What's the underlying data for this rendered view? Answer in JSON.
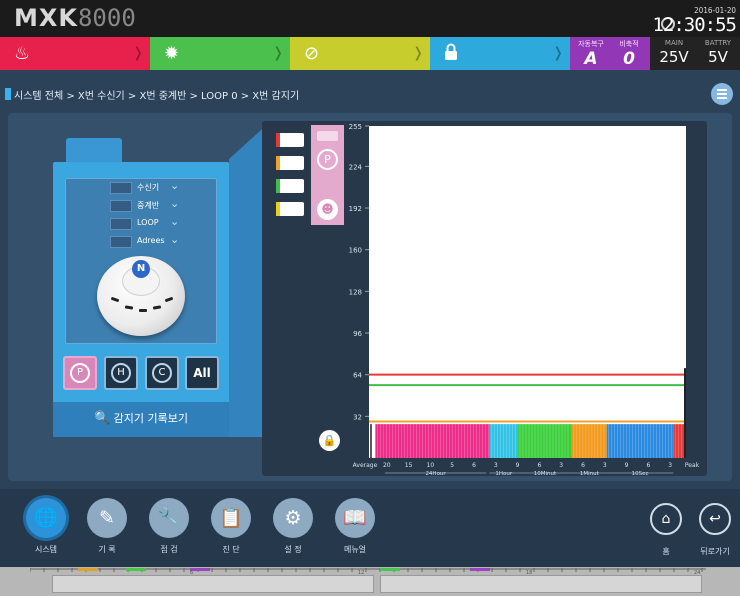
{
  "header": {
    "logo_text": "MXK",
    "logo_num": "8000",
    "date": "2016-01-20",
    "time": "12:30:55"
  },
  "status": {
    "fire_icon": "flame-icon",
    "trouble_icon": "gear-icon",
    "supervisory_icon": "no-entry-icon",
    "security_icon": "lock-icon",
    "auto_restore_label": "자동복구",
    "auto_restore_value": "A",
    "non_fire_label": "비축적",
    "non_fire_value": "0",
    "main_label": "MAIN",
    "main_value": "25V",
    "battery_label": "BATTRY",
    "battery_value": "5V",
    "colors": {
      "fire": "#e8214c",
      "trouble": "#4cc04d",
      "supervisory": "#c6cd2c",
      "security": "#2da9dc",
      "mode": "#9238b6"
    }
  },
  "breadcrumb": "시스템 전체 > X번 수신기 > X번 중계반 > LOOP 0 > X번 감지기",
  "selector": {
    "rows": [
      "수신기",
      "중계반",
      "LOOP",
      "Adrees"
    ],
    "detector_badge": "N",
    "mode_buttons": [
      "P",
      "H",
      "C",
      "All"
    ],
    "history_icon": "search-icon",
    "history_label": "감지기 기록보기"
  },
  "legend": {
    "colors": [
      "#e63a3a",
      "#f2a22c",
      "#3fbf4a",
      "#e6d21e"
    ],
    "p_label": "P"
  },
  "chart_data": {
    "type": "line",
    "ylim": [
      0,
      255
    ],
    "yticks": [
      32,
      64,
      96,
      128,
      160,
      192,
      224,
      255
    ],
    "thresholds": [
      {
        "value": 64,
        "color": "#e63a3a"
      },
      {
        "value": 56,
        "color": "#3fbf4a"
      },
      {
        "value": 28,
        "color": "#f2a22c"
      }
    ],
    "segments": [
      {
        "color": "#ee2d8a",
        "start": 0.02,
        "end": 0.38
      },
      {
        "color": "#31c2e6",
        "start": 0.38,
        "end": 0.47
      },
      {
        "color": "#3ccf3c",
        "start": 0.47,
        "end": 0.64
      },
      {
        "color": "#f29a1c",
        "start": 0.64,
        "end": 0.75
      },
      {
        "color": "#2b8ae0",
        "start": 0.75,
        "end": 0.96
      },
      {
        "color": "#e63a3a",
        "start": 0.96,
        "end": 1.0
      }
    ],
    "x_labels": [
      "Average",
      "20",
      "15",
      "10",
      "5",
      "6",
      "3",
      "9",
      "6",
      "3",
      "6",
      "3",
      "9",
      "6",
      "3",
      "Peak"
    ],
    "x_groups": [
      "24Hour",
      "1Hour",
      "10Minut",
      "1Minut",
      "10Sec"
    ]
  },
  "nav": {
    "items": [
      {
        "label": "시스템",
        "icon": "globe-icon"
      },
      {
        "label": "기  록",
        "icon": "pencil-icon"
      },
      {
        "label": "점  검",
        "icon": "wrench-icon"
      },
      {
        "label": "진  단",
        "icon": "clipboard-icon"
      },
      {
        "label": "설  정",
        "icon": "gear-icon"
      },
      {
        "label": "메뉴얼",
        "icon": "book-icon"
      }
    ],
    "home_label": "홈",
    "back_label": "뒤로가기"
  },
  "footer": {
    "ticks": [
      "6",
      "12",
      "18",
      "24"
    ]
  }
}
